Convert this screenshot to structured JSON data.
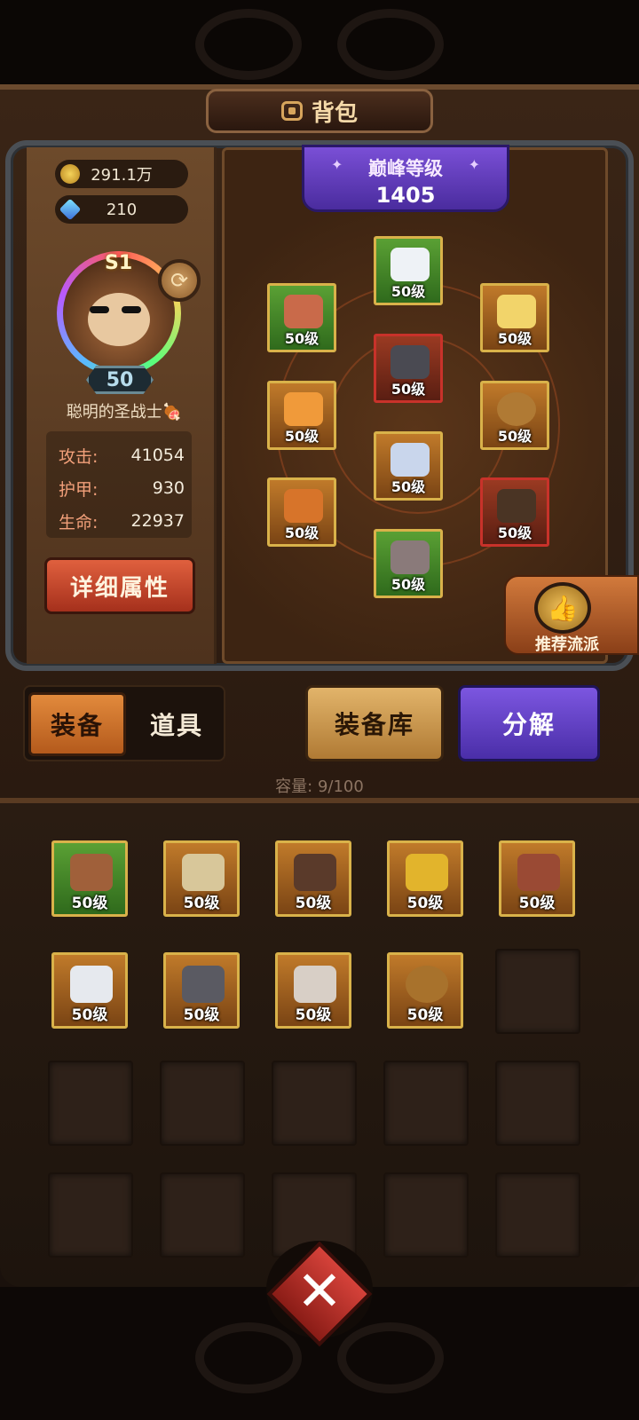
{
  "header": {
    "title": "背包",
    "icon": "backpack-icon"
  },
  "currency": {
    "gold": "291.1万",
    "gems": "210"
  },
  "hero": {
    "rank": "S1",
    "level": "50",
    "name": "聪明的圣战士",
    "stats": [
      {
        "label": "攻击:",
        "value": "41054"
      },
      {
        "label": "护甲:",
        "value": "930"
      },
      {
        "label": "生命:",
        "value": "22937"
      }
    ],
    "detail_button": "详细属性"
  },
  "peak": {
    "title": "巅峰等级",
    "value": "1405"
  },
  "equipped": [
    {
      "slot": "helmet",
      "level": "50级",
      "rarity": "green",
      "icon": "helmet-icon"
    },
    {
      "slot": "shoulder",
      "level": "50级",
      "rarity": "green",
      "icon": "shoulder-armor-icon"
    },
    {
      "slot": "wings",
      "level": "50级",
      "rarity": "orange",
      "icon": "wings-icon"
    },
    {
      "slot": "chest",
      "level": "50级",
      "rarity": "red",
      "icon": "chest-armor-icon"
    },
    {
      "slot": "gloves",
      "level": "50级",
      "rarity": "orange",
      "icon": "gauntlet-icon"
    },
    {
      "slot": "ring",
      "level": "50级",
      "rarity": "orange",
      "icon": "ring-icon"
    },
    {
      "slot": "pants",
      "level": "50级",
      "rarity": "orange",
      "icon": "pants-icon"
    },
    {
      "slot": "crossbow",
      "level": "50级",
      "rarity": "orange",
      "icon": "crossbow-icon"
    },
    {
      "slot": "quiver",
      "level": "50级",
      "rarity": "red",
      "icon": "quiver-icon"
    },
    {
      "slot": "boots",
      "level": "50级",
      "rarity": "green",
      "icon": "boots-icon"
    }
  ],
  "recommend": {
    "label": "推荐流派",
    "icon": "thumbs-up-icon"
  },
  "tabs": {
    "equipment": "装备",
    "items": "道具"
  },
  "buttons": {
    "storage": "装备库",
    "decompose": "分解"
  },
  "capacity": "容量: 9/100",
  "inventory": [
    {
      "level": "50级",
      "rarity": "green",
      "icon": "shoulder-armor-icon"
    },
    {
      "level": "50级",
      "rarity": "orange",
      "icon": "crossbow-icon"
    },
    {
      "level": "50级",
      "rarity": "orange",
      "icon": "crossbow-icon"
    },
    {
      "level": "50级",
      "rarity": "orange",
      "icon": "wings-icon"
    },
    {
      "level": "50级",
      "rarity": "orange",
      "icon": "gauntlet-icon"
    },
    {
      "level": "50级",
      "rarity": "orange",
      "icon": "gauntlet-icon"
    },
    {
      "level": "50级",
      "rarity": "orange",
      "icon": "gauntlet-icon"
    },
    {
      "level": "50级",
      "rarity": "orange",
      "icon": "helmet-icon"
    },
    {
      "level": "50级",
      "rarity": "orange",
      "icon": "ring-icon"
    }
  ],
  "close_icon": "close-icon"
}
